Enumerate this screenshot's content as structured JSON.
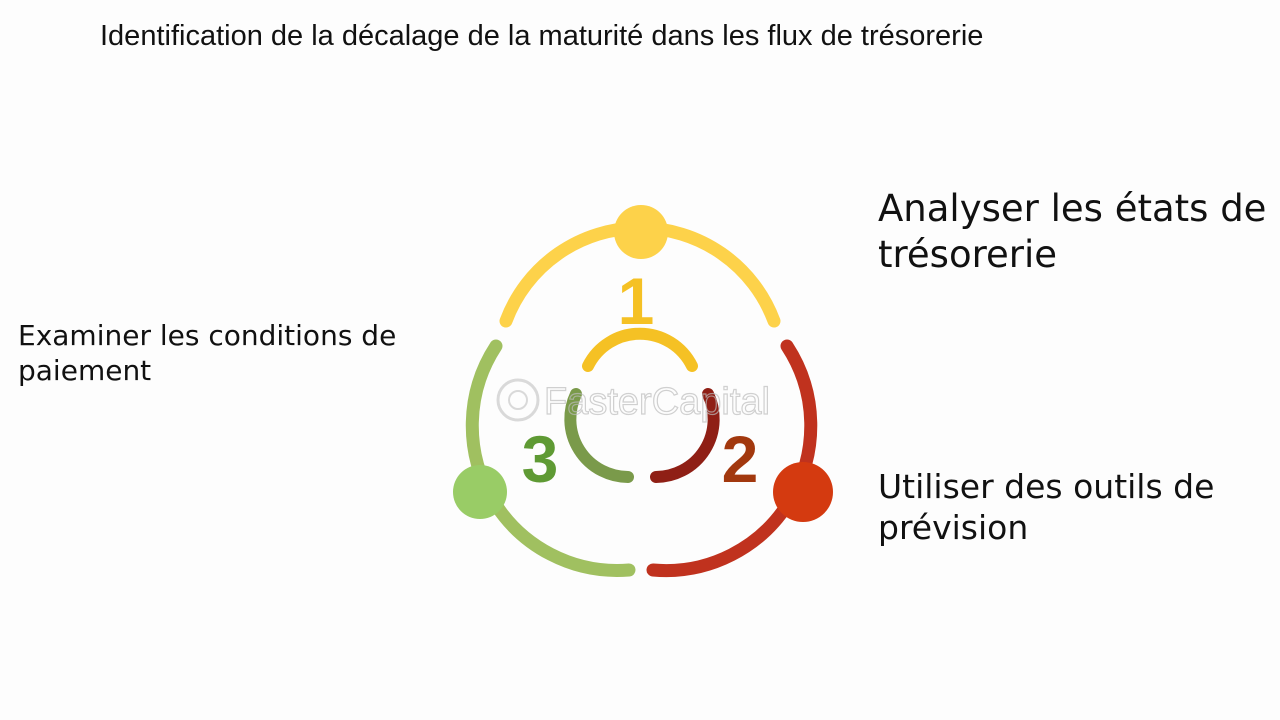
{
  "title": "Identification de la décalage de la maturité dans les flux de trésorerie",
  "steps": [
    {
      "number": "1",
      "label": "Analyser les états de trésorerie",
      "color": "#f5c124"
    },
    {
      "number": "2",
      "label": "Utiliser des outils de prévision",
      "color": "#c0321e"
    },
    {
      "number": "3",
      "label": "Examiner les conditions de paiement",
      "color": "#6a9a3a"
    }
  ],
  "watermark": "FasterCapital",
  "colors": {
    "yellow_light": "#fdd24a",
    "yellow": "#f5c124",
    "red": "#c0321e",
    "red_dot": "#d43a10",
    "red_dark": "#8f1f15",
    "green_light": "#a0c060",
    "green_dot": "#99cc66",
    "green": "#5f9a34",
    "green_inner": "#7a9a4a",
    "number_red": "#a2380e"
  },
  "icons": [
    "person-yellow-icon",
    "person-red-icon",
    "person-green-icon",
    "watermark-logo-icon"
  ]
}
